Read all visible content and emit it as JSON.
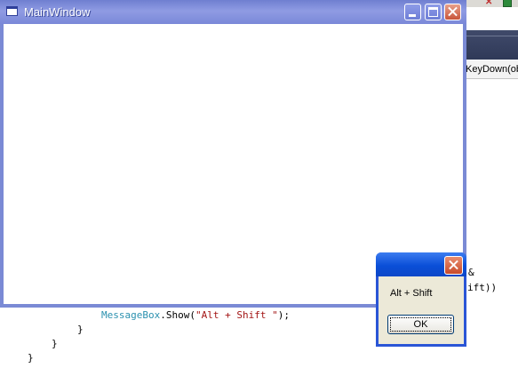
{
  "main_window": {
    "title": "MainWindow",
    "icons": [
      "window-app-icon",
      "minimize-icon",
      "maximize-icon",
      "close-icon"
    ]
  },
  "message_box": {
    "text": "Alt + Shift",
    "ok_label": "OK",
    "icons": [
      "close-icon"
    ]
  },
  "editor": {
    "member_dropdown": "KeyDown(ob",
    "visible_fragments": [
      "&",
      "ift))"
    ],
    "call_type": "MessageBox",
    "call_rest": ".Show(",
    "call_string": "\"Alt + Shift \"",
    "call_end": ");",
    "brace_inner": "}",
    "brace_middle": "}",
    "brace_outer": "}"
  },
  "colors": {
    "titlebar_main": "#7a88d8",
    "titlebar_msg": "#0a4fd8",
    "close_button": "#c84a2a",
    "dialog_face": "#ece9d8",
    "code_type": "#2b91af",
    "code_string": "#a31515"
  }
}
